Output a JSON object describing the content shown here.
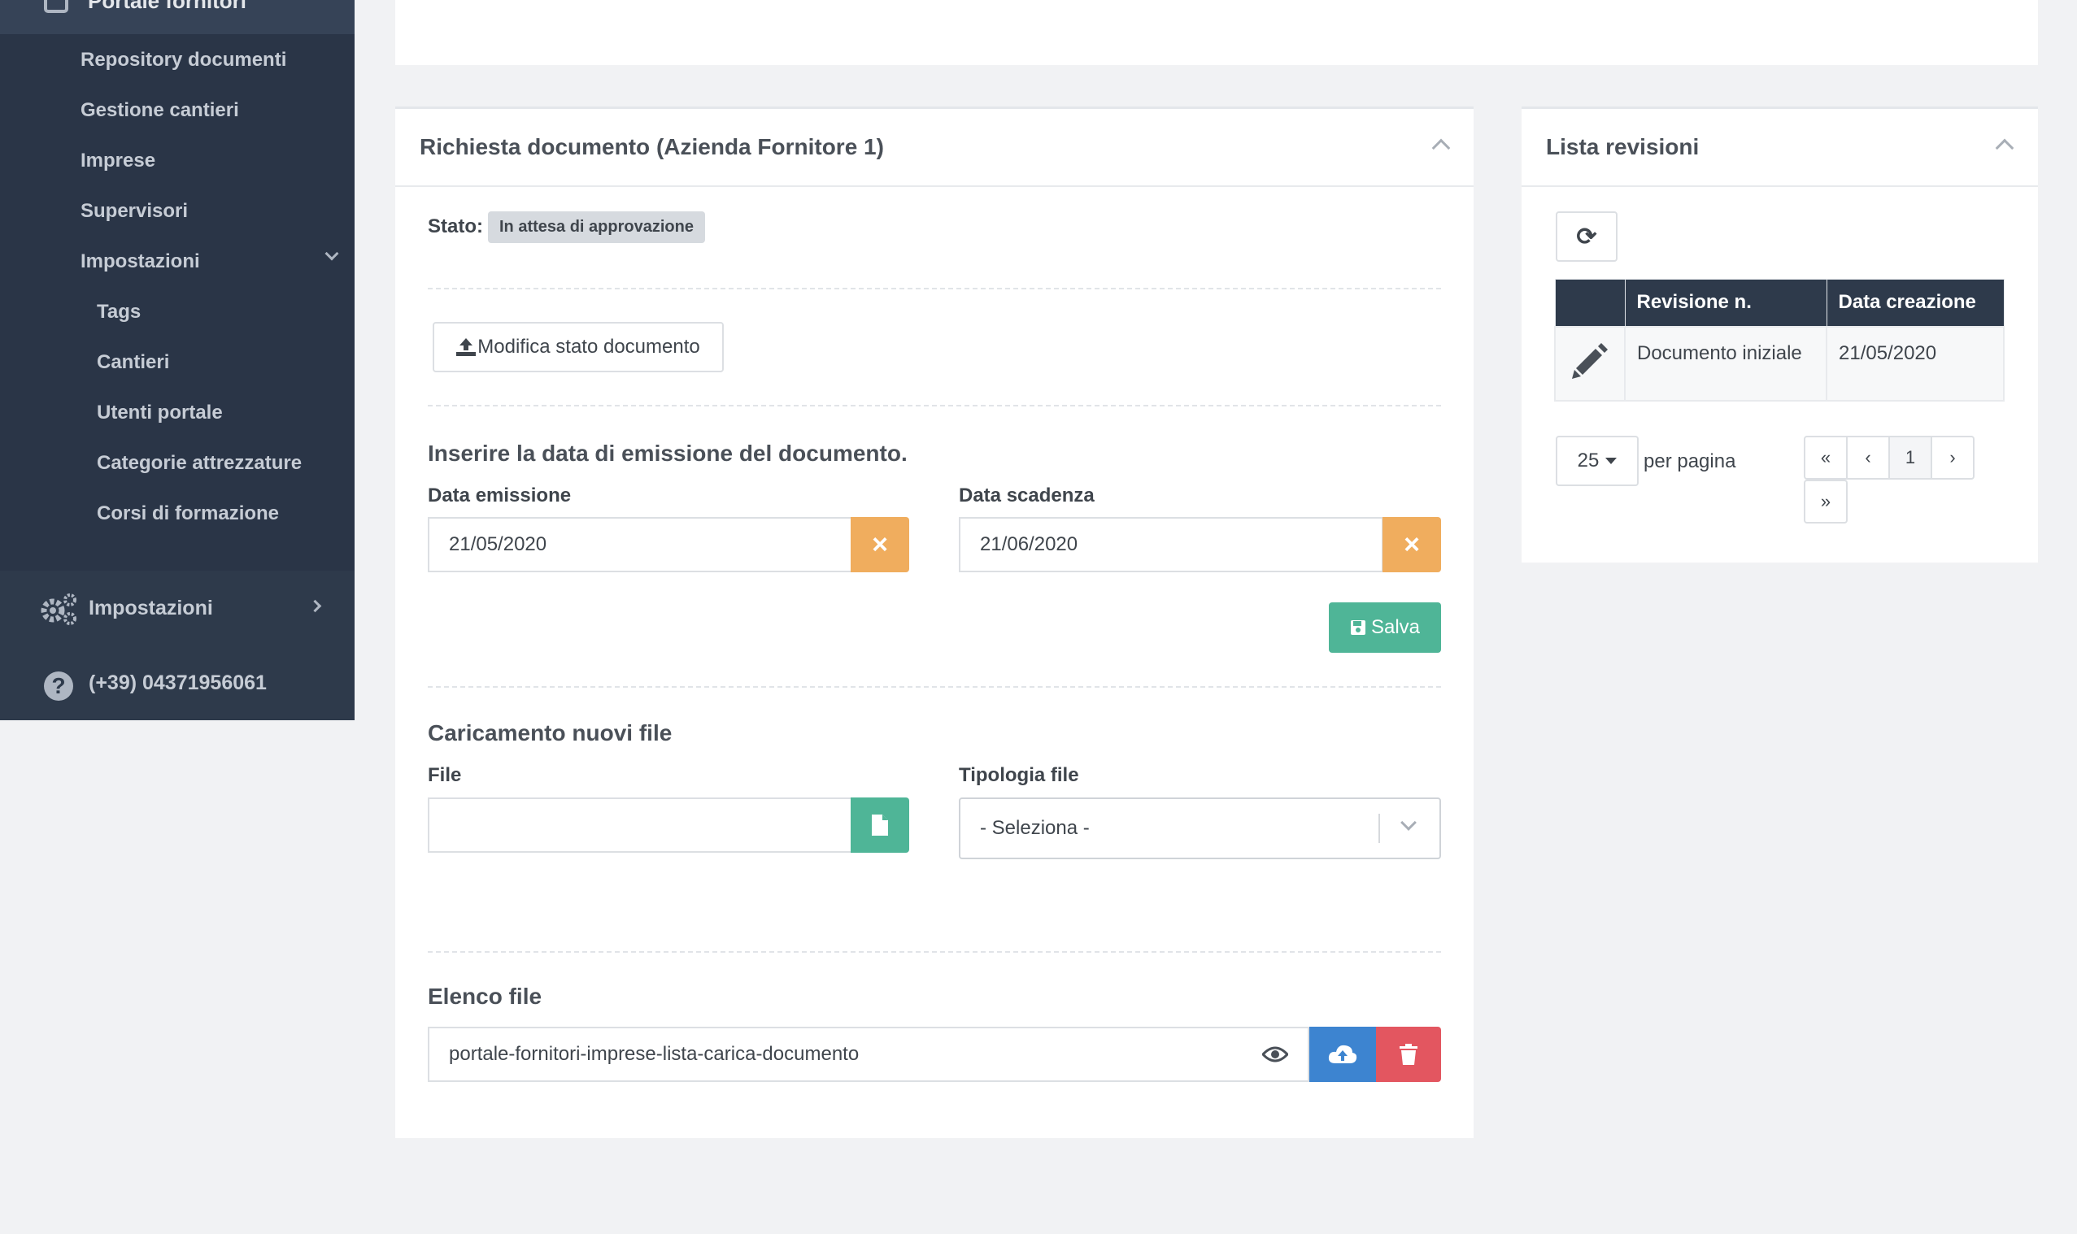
{
  "sidebar": {
    "top_item": "Portale fornitori",
    "sub_items": [
      "Repository documenti",
      "Gestione cantieri",
      "Imprese",
      "Supervisori",
      "Impostazioni"
    ],
    "nested_items": [
      "Tags",
      "Cantieri",
      "Utenti portale",
      "Categorie attrezzature",
      "Corsi di formazione"
    ],
    "settings_label": "Impostazioni",
    "phone": "(+39) 04371956061"
  },
  "document_panel": {
    "title": "Richiesta documento (Azienda Fornitore 1)",
    "status_label": "Stato:",
    "status_value": "In attesa di approvazione",
    "modify_button": "Modifica stato documento",
    "date_section_title": "Inserire la data di emissione del documento.",
    "issue_date_label": "Data emissione",
    "issue_date_value": "21/05/2020",
    "expiry_date_label": "Data scadenza",
    "expiry_date_value": "21/06/2020",
    "save_button": "Salva",
    "upload_section_title": "Caricamento nuovi file",
    "file_label": "File",
    "file_value": "",
    "file_type_label": "Tipologia file",
    "file_type_selected": "- Seleziona -",
    "file_list_title": "Elenco file",
    "file_list": [
      "portale-fornitori-imprese-lista-carica-documento"
    ]
  },
  "revisions_panel": {
    "title": "Lista revisioni",
    "columns": [
      "Revisione n.",
      "Data creazione"
    ],
    "rows": [
      {
        "revision": "Documento iniziale",
        "date": "21/05/2020"
      }
    ],
    "page_size": "25",
    "per_page_label": "per pagina",
    "pagination": [
      "«",
      "‹",
      "1",
      "›",
      "»"
    ]
  },
  "icons": {
    "refresh": "⟳",
    "edit": "pencil-icon",
    "eye": "eye-icon",
    "upload": "cloud-upload-icon",
    "trash": "trash-icon"
  },
  "colors": {
    "sidebar": "#2e3a4b",
    "orange": "#f0ad5e",
    "green": "#4fb597",
    "blue": "#3d84d0",
    "red": "#e35660"
  }
}
